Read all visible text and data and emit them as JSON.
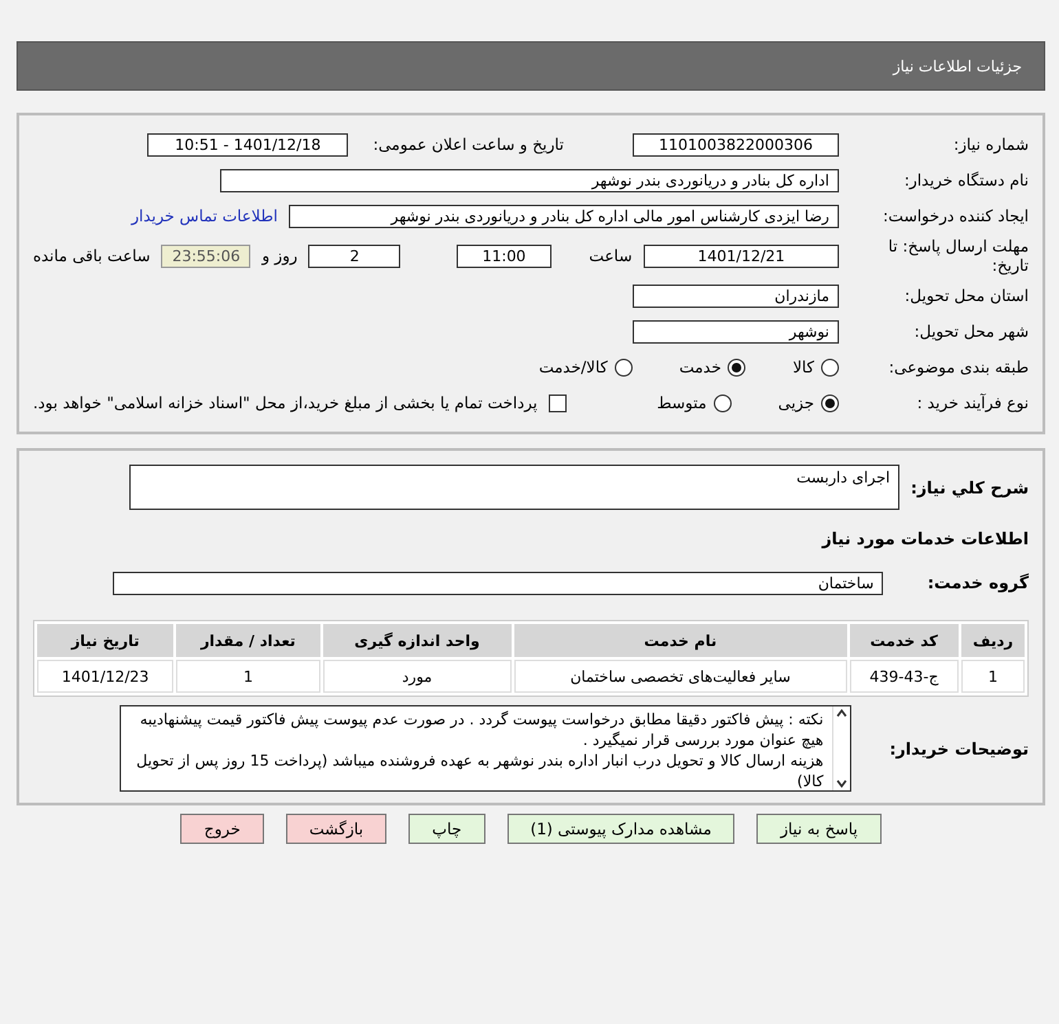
{
  "header": {
    "title": "جزئیات اطلاعات نیاز"
  },
  "details": {
    "need_number": {
      "label": "شماره نیاز:",
      "value": "1101003822000306"
    },
    "announce": {
      "label": "تاریخ و ساعت اعلان عمومی:",
      "value": "1401/12/18 - 10:51"
    },
    "buyer_org": {
      "label": "نام دستگاه خریدار:",
      "value": "اداره کل بنادر و دریانوردی بندر نوشهر"
    },
    "creator": {
      "label": "ایجاد کننده درخواست:",
      "value": "رضا ایزدی کارشناس امور مالی اداره کل بنادر و دریانوردی بندر نوشهر",
      "link": "اطلاعات تماس خریدار"
    },
    "deadline": {
      "label": "مهلت ارسال پاسخ: تا تاریخ:",
      "date": "1401/12/21",
      "time_label": "ساعت",
      "time": "11:00",
      "days": "2",
      "days_label": "روز و",
      "remaining": "23:55:06",
      "remaining_label": "ساعت باقی مانده"
    },
    "province": {
      "label": "استان محل تحویل:",
      "value": "مازندران"
    },
    "city": {
      "label": "شهر محل تحویل:",
      "value": "نوشهر"
    },
    "category": {
      "label": "طبقه بندی موضوعی:",
      "options": [
        {
          "label": "کالا",
          "selected": false
        },
        {
          "label": "خدمت",
          "selected": true
        },
        {
          "label": "کالا/خدمت",
          "selected": false
        }
      ]
    },
    "process": {
      "label": "نوع فرآیند خرید :",
      "options": [
        {
          "label": "جزیی",
          "selected": true
        },
        {
          "label": "متوسط",
          "selected": false
        }
      ],
      "payment": {
        "label": "پرداخت تمام یا بخشی از مبلغ خرید،از محل \"اسناد خزانه اسلامی\" خواهد بود.",
        "checked": false
      }
    }
  },
  "needs": {
    "summary": {
      "label": "شرح کلي نياز:",
      "value": "اجرای داربست"
    },
    "services_title": "اطلاعات خدمات مورد نیاز",
    "service_group": {
      "label": "گروه خدمت:",
      "value": "ساختمان"
    },
    "table": {
      "columns": [
        "ردیف",
        "کد خدمت",
        "نام خدمت",
        "واحد اندازه گیری",
        "تعداد / مقدار",
        "تاریخ نیاز"
      ],
      "rows": [
        [
          "1",
          "ج-43-439",
          "سایر فعالیت‌های تخصصی ساختمان",
          "مورد",
          "1",
          "1401/12/23"
        ]
      ]
    },
    "buyer_notes": {
      "label": "توضیحات خریدار:",
      "lines": [
        "نکته : پیش فاکتور دقیقا مطابق درخواست پیوست گردد . در صورت عدم پیوست پیش فاکتور قیمت پیشنهادیبه  هیچ عنوان مورد بررسی قرار نمیگیرد  .",
        "هزینه ارسال کالا و تحویل درب انبار اداره بندر نوشهر به عهده فروشنده میباشد (پرداخت 15 روز پس از تحویل کالا)"
      ]
    }
  },
  "buttons": [
    {
      "label": "پاسخ به نیاز",
      "kind": "primary"
    },
    {
      "label": "مشاهده مدارک پیوستی (1)",
      "kind": "primary"
    },
    {
      "label": "چاپ",
      "kind": "primary"
    },
    {
      "label": "بازگشت",
      "kind": "danger"
    },
    {
      "label": "خروج",
      "kind": "danger"
    }
  ]
}
